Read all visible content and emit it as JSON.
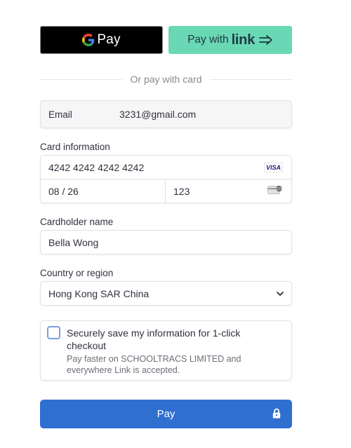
{
  "wallets": {
    "gpay_label": "Pay",
    "link_pay_label": "Pay with",
    "link_brand": "link",
    "link_arrow_icon": "double-arrow-right-icon"
  },
  "divider": {
    "text": "Or pay with card"
  },
  "email": {
    "label": "Email",
    "value": "3231@gmail.com"
  },
  "card": {
    "label": "Card information",
    "number": "4242 4242 4242 4242",
    "brand": "VISA",
    "expiry": "08 / 26",
    "cvc": "123",
    "cvc_icon": "card-back-cvc-icon"
  },
  "cardholder": {
    "label": "Cardholder name",
    "value": "Bella Wong"
  },
  "country": {
    "label": "Country or region",
    "value": "Hong Kong SAR China",
    "icon": "chevron-down-icon"
  },
  "save_info": {
    "checked": false,
    "title": "Securely save my information for 1-click checkout",
    "subtitle": "Pay faster on SCHOOLTRACS LIMITED and everywhere Link is accepted."
  },
  "pay_button": {
    "label": "Pay",
    "icon": "lock-icon"
  },
  "colors": {
    "link_green": "#6ad8b4",
    "pay_blue": "#2f6fd0",
    "checkbox_border": "#7a9fe0"
  }
}
